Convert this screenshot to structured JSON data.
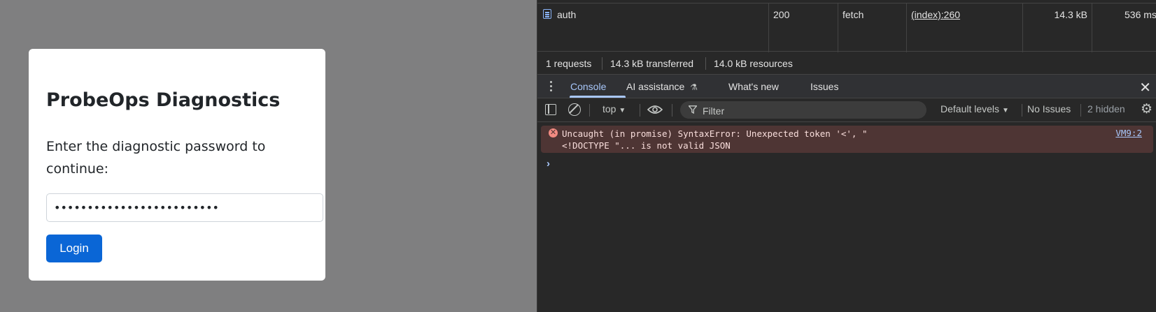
{
  "page": {
    "card": {
      "title": "ProbeOps Diagnostics",
      "description": "Enter the diagnostic password to continue:",
      "password_value": "•••••••••••••••••••••••••",
      "login_label": "Login"
    }
  },
  "devtools": {
    "network_row": {
      "name": "auth",
      "status": "200",
      "type": "fetch",
      "initiator": "(index):260",
      "size": "14.3 kB",
      "time": "536 ms"
    },
    "summary": {
      "requests": "1 requests",
      "transferred": "14.3 kB transferred",
      "resources": "14.0 kB resources"
    },
    "tabs": {
      "console": "Console",
      "ai": "AI assistance",
      "whats_new": "What's new",
      "issues": "Issues",
      "close": "✕"
    },
    "toolbar": {
      "context": "top",
      "filter_placeholder": "Filter",
      "levels": "Default levels",
      "no_issues": "No Issues",
      "hidden": "2 hidden"
    },
    "console": {
      "error_line1": "Uncaught (in promise) SyntaxError: Unexpected token '<', \"",
      "error_line2": "<!DOCTYPE \"... is not valid JSON",
      "error_source": "VM9:2",
      "prompt": "›"
    },
    "colors": {
      "page_bg": "#7f7f80",
      "primary_button": "#0a66d6",
      "devtools_bg": "#282828",
      "accent": "#a8c7fa",
      "error_bg": "#4e3534"
    }
  }
}
